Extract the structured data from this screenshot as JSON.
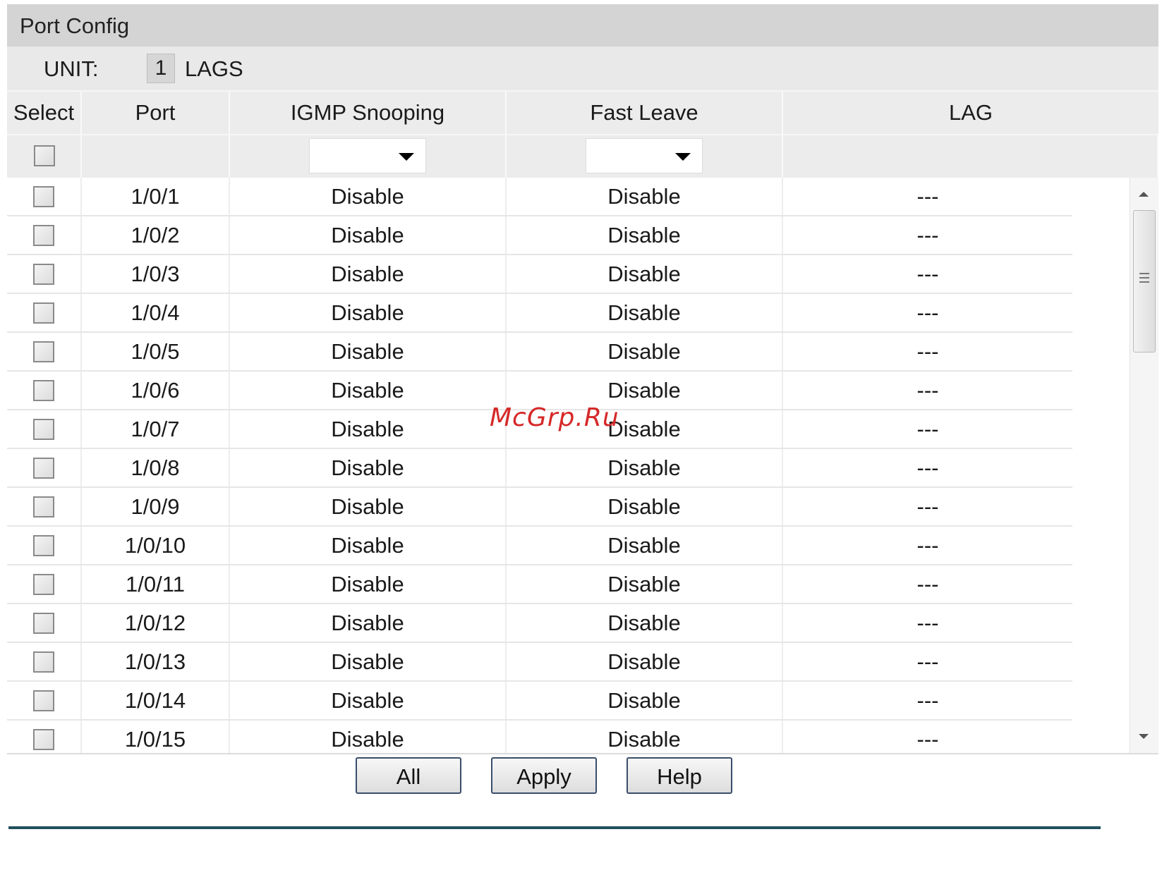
{
  "panel": {
    "title": "Port Config"
  },
  "unit": {
    "label": "UNIT:",
    "value": "1",
    "lags_label": "LAGS"
  },
  "table": {
    "headers": {
      "select": "Select",
      "port": "Port",
      "igmp": "IGMP Snooping",
      "fast": "Fast Leave",
      "lag": "LAG"
    },
    "filter": {
      "igmp_value": "",
      "fast_value": ""
    },
    "rows": [
      {
        "port": "1/0/1",
        "igmp": "Disable",
        "fast": "Disable",
        "lag": "---"
      },
      {
        "port": "1/0/2",
        "igmp": "Disable",
        "fast": "Disable",
        "lag": "---"
      },
      {
        "port": "1/0/3",
        "igmp": "Disable",
        "fast": "Disable",
        "lag": "---"
      },
      {
        "port": "1/0/4",
        "igmp": "Disable",
        "fast": "Disable",
        "lag": "---"
      },
      {
        "port": "1/0/5",
        "igmp": "Disable",
        "fast": "Disable",
        "lag": "---"
      },
      {
        "port": "1/0/6",
        "igmp": "Disable",
        "fast": "Disable",
        "lag": "---"
      },
      {
        "port": "1/0/7",
        "igmp": "Disable",
        "fast": "Disable",
        "lag": "---"
      },
      {
        "port": "1/0/8",
        "igmp": "Disable",
        "fast": "Disable",
        "lag": "---"
      },
      {
        "port": "1/0/9",
        "igmp": "Disable",
        "fast": "Disable",
        "lag": "---"
      },
      {
        "port": "1/0/10",
        "igmp": "Disable",
        "fast": "Disable",
        "lag": "---"
      },
      {
        "port": "1/0/11",
        "igmp": "Disable",
        "fast": "Disable",
        "lag": "---"
      },
      {
        "port": "1/0/12",
        "igmp": "Disable",
        "fast": "Disable",
        "lag": "---"
      },
      {
        "port": "1/0/13",
        "igmp": "Disable",
        "fast": "Disable",
        "lag": "---"
      },
      {
        "port": "1/0/14",
        "igmp": "Disable",
        "fast": "Disable",
        "lag": "---"
      },
      {
        "port": "1/0/15",
        "igmp": "Disable",
        "fast": "Disable",
        "lag": "---"
      }
    ]
  },
  "buttons": {
    "all": "All",
    "apply": "Apply",
    "help": "Help"
  },
  "watermark": "McGrp.Ru",
  "colors": {
    "title_bar": "#d4d4d4",
    "rule": "#21505c",
    "watermark": "#d62828"
  }
}
